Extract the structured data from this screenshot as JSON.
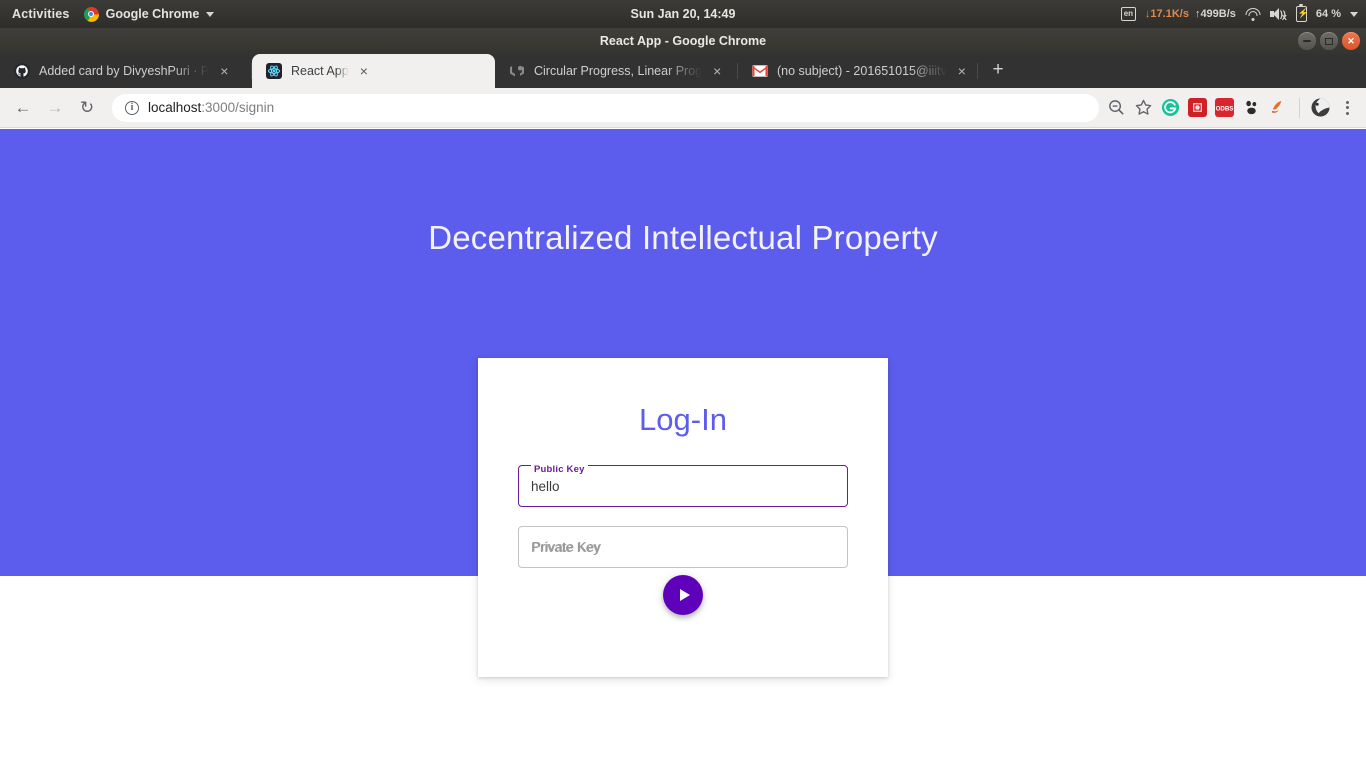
{
  "gnome": {
    "activities": "Activities",
    "app_menu": "Google Chrome",
    "clock": "Sun Jan 20, 14:49",
    "tray": {
      "keyboard_layout": "en",
      "download_speed": "↓17.1K/s",
      "upload_speed": "↑499B/s",
      "battery_percent": "64 %"
    }
  },
  "window": {
    "title": "React App - Google Chrome"
  },
  "browser": {
    "tabs": [
      {
        "title": "Added card by DivyeshPuri · P",
        "icon": "github-icon",
        "active": false
      },
      {
        "title": "React App",
        "icon": "react-icon",
        "active": true
      },
      {
        "title": "Circular Progress, Linear Prog",
        "icon": "material-ui-icon",
        "active": false
      },
      {
        "title": "(no subject) - 201651015@iiitv",
        "icon": "gmail-icon",
        "active": false
      }
    ],
    "new_tab_label": "+",
    "close_tab_label": "×",
    "toolbar": {
      "back_label": "←",
      "forward_label": "→",
      "reload_label": "↻",
      "url_host": "localhost",
      "url_rest": ":3000/signin",
      "extensions": [
        "zoom-out-icon",
        "bookmark-star-icon",
        "grammarly-icon",
        "red-extension-icon",
        "odbs-extension-icon",
        "gnome-extension-icon",
        "orange-extension-icon",
        "profile-avatar",
        "chrome-menu-icon"
      ],
      "odbs_label": "ODBS"
    }
  },
  "page": {
    "hero_title": "Decentralized Intellectual Property",
    "card": {
      "title": "Log-In",
      "fields": [
        {
          "name": "public-key",
          "label": "Public Key",
          "value": "hello",
          "placeholder": "",
          "focused": true
        },
        {
          "name": "private-key",
          "label": "Private Key",
          "value": "",
          "placeholder": "Private Key",
          "focused": false
        }
      ],
      "submit_icon": "play-arrow-icon"
    },
    "colors": {
      "hero_background": "#5c5ced",
      "title_accent": "#5c5ced",
      "focused_field": "#6a1b9a",
      "fab_background": "#5f01bb"
    }
  }
}
